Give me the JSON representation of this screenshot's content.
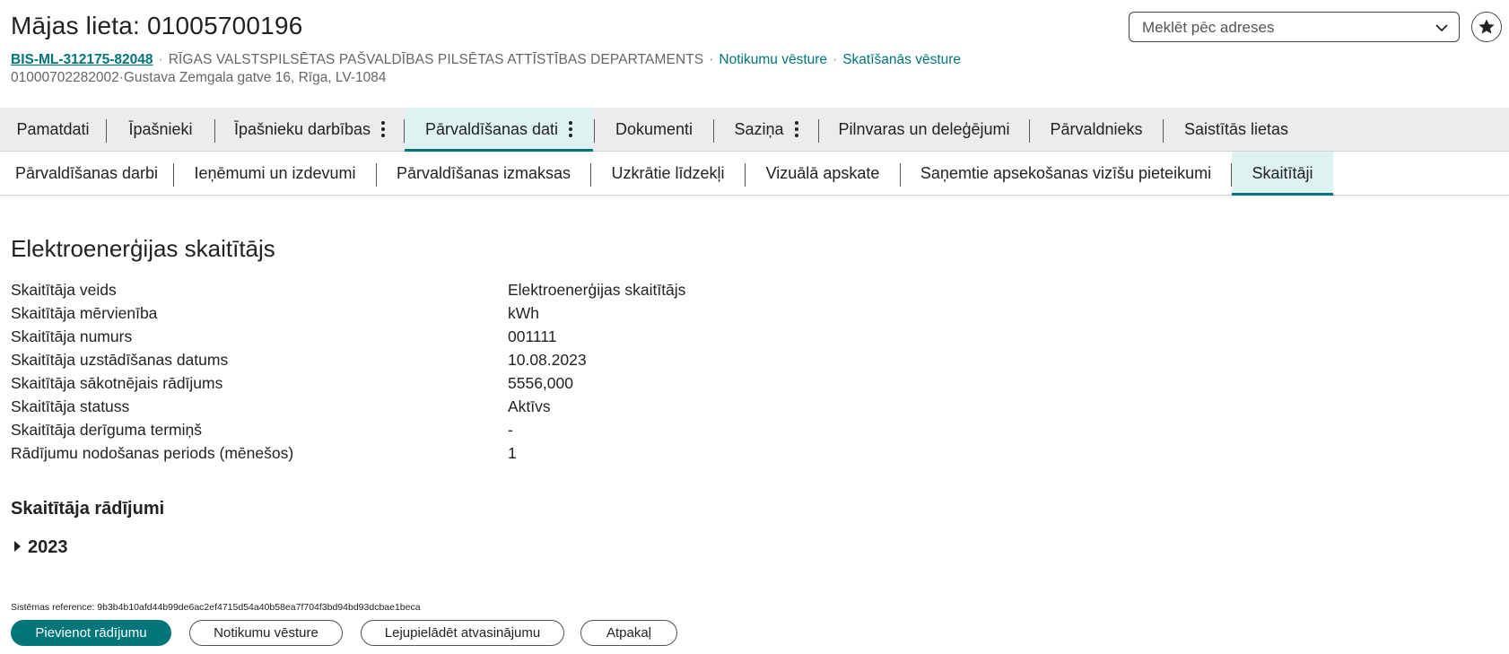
{
  "header": {
    "title": "Mājas lieta: 01005700196",
    "case_ref": "BIS-ML-312175-82048",
    "department": "RĪGAS VALSTSPILSĒTAS PAŠVALDĪBAS PILSĒTAS ATTĪSTĪBAS DEPARTAMENTS",
    "event_history_link": "Notikumu vēsture",
    "view_history_link": "Skatīšanās vēsture",
    "cadastre": "01000702282002",
    "address": "Gustava Zemgala gatve 16, Rīga, LV-1084",
    "sep": "·"
  },
  "search": {
    "placeholder": "Meklēt pēc adreses",
    "icon": "chevron-down-icon"
  },
  "favorite_icon": "star-icon",
  "tabs": [
    {
      "label": "Pamatdati",
      "kebab": false,
      "active": false
    },
    {
      "label": "Īpašnieki",
      "kebab": false,
      "active": false
    },
    {
      "label": "Īpašnieku darbības",
      "kebab": true,
      "active": false
    },
    {
      "label": "Pārvaldīšanas dati",
      "kebab": true,
      "active": true
    },
    {
      "label": "Dokumenti",
      "kebab": false,
      "active": false
    },
    {
      "label": "Saziņa",
      "kebab": true,
      "active": false
    },
    {
      "label": "Pilnvaras un deleģējumi",
      "kebab": false,
      "active": false
    },
    {
      "label": "Pārvaldnieks",
      "kebab": false,
      "active": false
    },
    {
      "label": "Saistītās lietas",
      "kebab": false,
      "active": false
    }
  ],
  "subtabs": [
    {
      "label": "Pārvaldīšanas darbi",
      "active": false
    },
    {
      "label": "Ieņēmumi un izdevumi",
      "active": false
    },
    {
      "label": "Pārvaldīšanas izmaksas",
      "active": false
    },
    {
      "label": "Uzkrātie līdzekļi",
      "active": false
    },
    {
      "label": "Vizuālā apskate",
      "active": false
    },
    {
      "label": "Saņemtie apsekošanas vizīšu pieteikumi",
      "active": false
    },
    {
      "label": "Skaitītāji",
      "active": true
    }
  ],
  "meter": {
    "section_title": "Elektroenerģijas skaitītājs",
    "fields": [
      {
        "label": "Skaitītāja veids",
        "value": "Elektroenerģijas skaitītājs"
      },
      {
        "label": "Skaitītāja mērvienība",
        "value": "kWh"
      },
      {
        "label": "Skaitītāja numurs",
        "value": "001111"
      },
      {
        "label": "Skaitītāja uzstādīšanas datums",
        "value": "10.08.2023"
      },
      {
        "label": "Skaitītāja sākotnējais rādījums",
        "value": "5556,000"
      },
      {
        "label": "Skaitītāja statuss",
        "value": "Aktīvs"
      },
      {
        "label": "Skaitītāja derīguma termiņš",
        "value": "-"
      },
      {
        "label": "Rādījumu nodošanas periods (mēnešos)",
        "value": "1"
      }
    ]
  },
  "readings": {
    "title": "Skaitītāja rādījumi",
    "year": "2023"
  },
  "system_reference": "Sistēmas reference: 9b3b4b10afd44b99de6ac2ef4715d54a40b58ea7f704f3bd94bd93dcbae1beca",
  "actions": {
    "add_reading": "Pievienot rādījumu",
    "event_history": "Notikumu vēsture",
    "download_extract": "Lejupielādēt atvasinājumu",
    "back": "Atpakaļ"
  },
  "colors": {
    "accent": "#00767a",
    "active_tab_bg": "#dff2f2",
    "tab_bar_bg": "#ececec"
  }
}
